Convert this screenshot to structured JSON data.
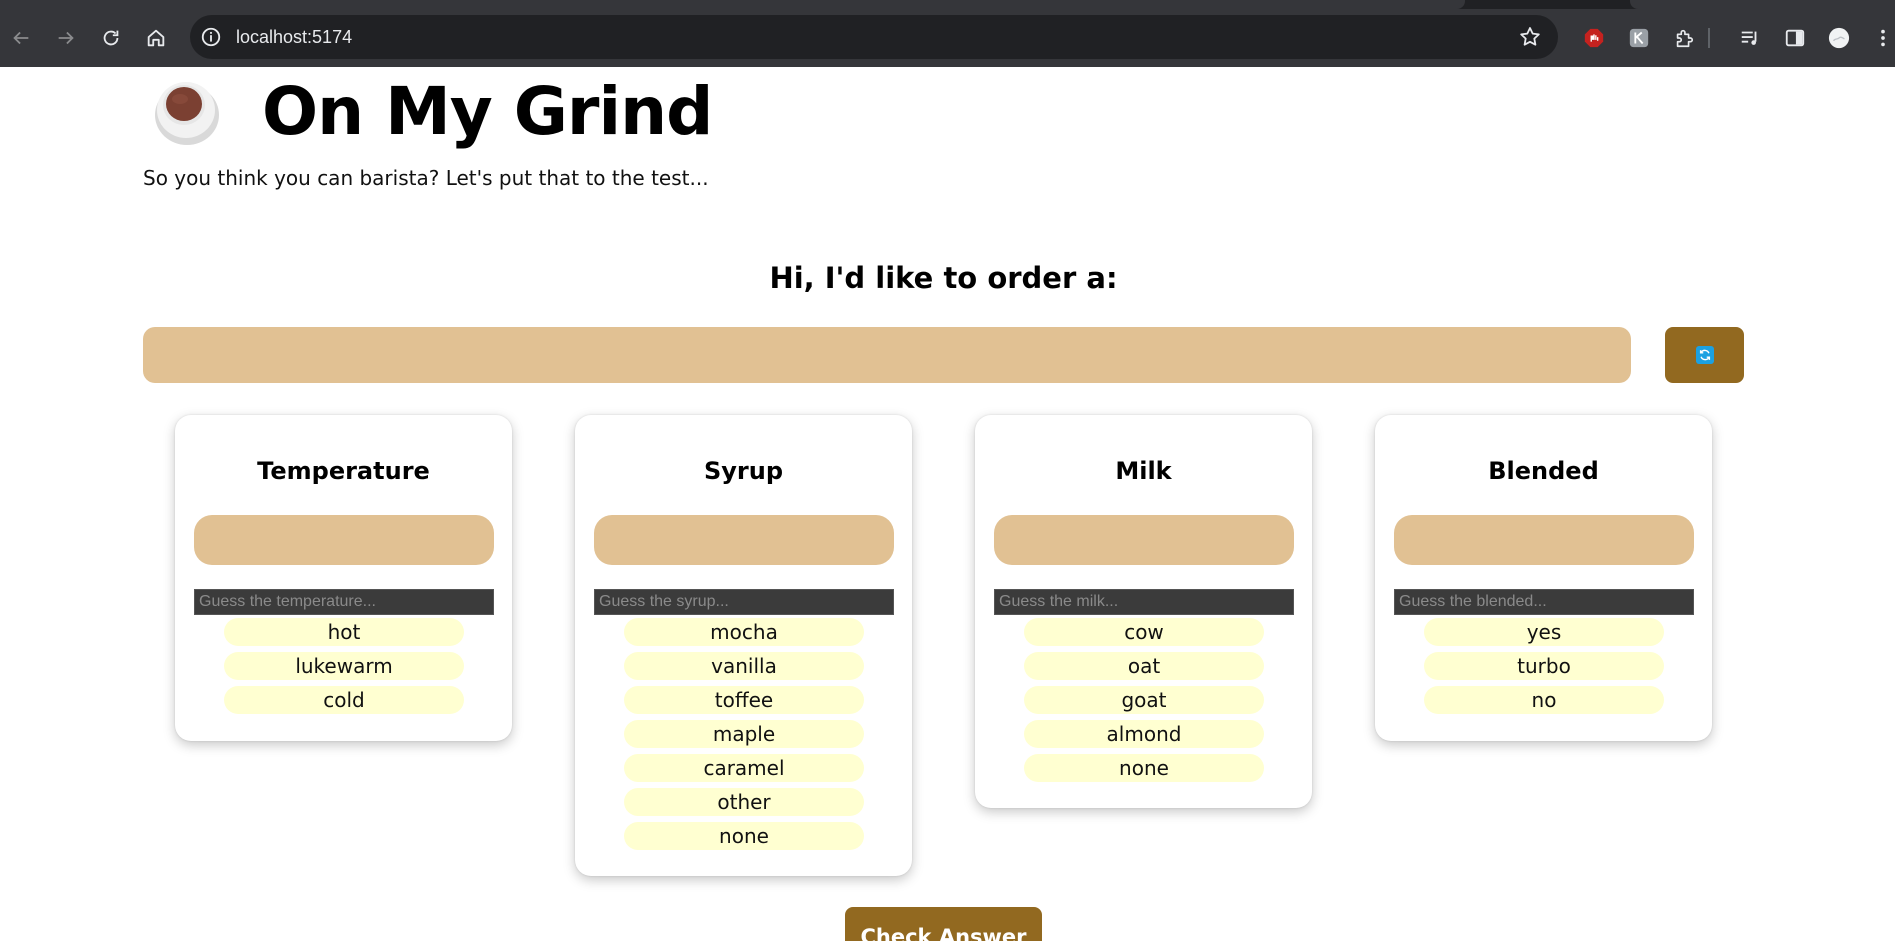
{
  "browser": {
    "url": "localhost:5174"
  },
  "header": {
    "icon": "coffee-cup-icon",
    "title": "On My Grind",
    "subtitle": "So you think you can barista? Let's put that to the test..."
  },
  "order": {
    "heading": "Hi, I'd like to order a:",
    "refresh_icon": "refresh-icon"
  },
  "categories": [
    {
      "title": "Temperature",
      "placeholder": "Guess the temperature...",
      "options": [
        "hot",
        "lukewarm",
        "cold"
      ]
    },
    {
      "title": "Syrup",
      "placeholder": "Guess the syrup...",
      "options": [
        "mocha",
        "vanilla",
        "toffee",
        "maple",
        "caramel",
        "other",
        "none"
      ]
    },
    {
      "title": "Milk",
      "placeholder": "Guess the milk...",
      "options": [
        "cow",
        "oat",
        "goat",
        "almond",
        "none"
      ]
    },
    {
      "title": "Blended",
      "placeholder": "Guess the blended...",
      "options": [
        "yes",
        "turbo",
        "no"
      ]
    }
  ],
  "actions": {
    "check_label": "Check Answer"
  },
  "colors": {
    "accent": "#926920",
    "slot": "#e1c193",
    "option": "#ffffd1"
  }
}
